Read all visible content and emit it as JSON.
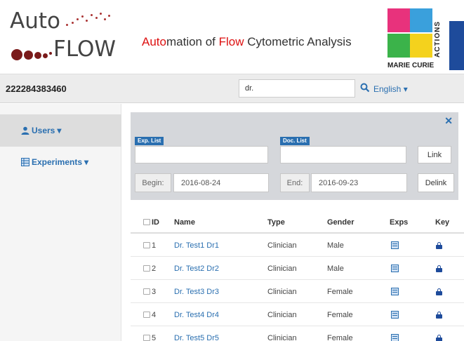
{
  "header": {
    "logo_auto": "Auto",
    "logo_flow": "FLOW",
    "title_part1": "Auto",
    "title_part2": "mation of ",
    "title_part3": "Flow",
    "title_part4": " Cytometric Analysis",
    "eu_actions": "ACTIONS",
    "eu_marie": "MARIE CURIE"
  },
  "navbar": {
    "user_id": "222284383460",
    "search_value": "dr.",
    "language": "English"
  },
  "sidebar": {
    "items": [
      {
        "label": "Users",
        "icon": "user-icon"
      },
      {
        "label": "Experiments",
        "icon": "table-icon"
      }
    ]
  },
  "filter": {
    "exp_list_label": "Exp. List",
    "doc_list_label": "Doc. List",
    "exp_list_value": "",
    "doc_list_value": "",
    "link_label": "Link",
    "delink_label": "Delink",
    "begin_label": "Begin:",
    "begin_value": "2016-08-24",
    "end_label": "End:",
    "end_value": "2016-09-23"
  },
  "table": {
    "columns": [
      "ID",
      "Name",
      "Type",
      "Gender",
      "Exps",
      "Key"
    ],
    "rows": [
      {
        "id": "1",
        "name": "Dr. Test1 Dr1",
        "type": "Clinician",
        "gender": "Male"
      },
      {
        "id": "2",
        "name": "Dr. Test2 Dr2",
        "type": "Clinician",
        "gender": "Male"
      },
      {
        "id": "3",
        "name": "Dr. Test3 Dr3",
        "type": "Clinician",
        "gender": "Female"
      },
      {
        "id": "4",
        "name": "Dr. Test4 Dr4",
        "type": "Clinician",
        "gender": "Female"
      },
      {
        "id": "5",
        "name": "Dr. Test5 Dr5",
        "type": "Clinician",
        "gender": "Female"
      }
    ]
  },
  "colors": {
    "accent": "#2a6fb0",
    "title_highlight": "#dd1111",
    "logo_dot": "#7a1a1a"
  }
}
